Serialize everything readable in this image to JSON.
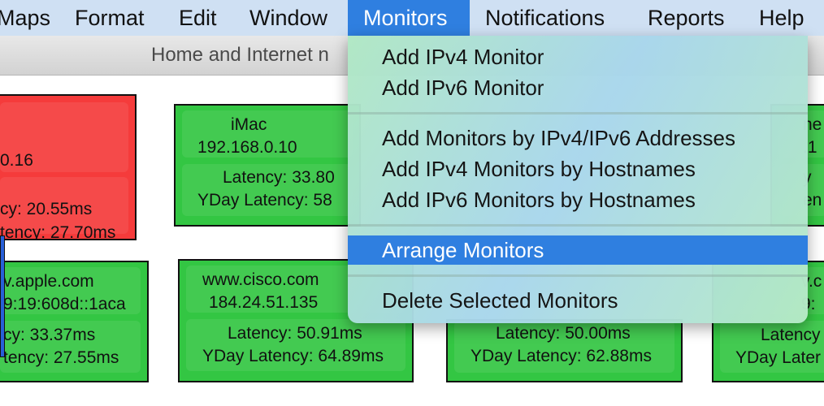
{
  "menubar": {
    "items": [
      "Maps",
      "Format",
      "Edit",
      "Window",
      "Monitors",
      "Notifications",
      "Reports",
      "Help"
    ],
    "active": "Monitors"
  },
  "window": {
    "title": "Home and Internet n"
  },
  "tiles": [
    {
      "l1": "0.16",
      "l2": "cy: 20.55ms",
      "l3": "tency: 27.70ms"
    },
    {
      "l1": "iMac",
      "l2": "192.168.0.10",
      "l3": "Latency: 33.80",
      "l4": "YDay Latency: 58"
    },
    {
      "l1": "ne",
      "l2": ".1",
      "l3": "y",
      "l4": "en"
    },
    {
      "l1": "v.apple.com",
      "l2": "9:19:608d::1aca",
      "l3": "cy: 33.37ms",
      "l4": "tency: 27.55ms"
    },
    {
      "l1": "www.cisco.com",
      "l2": "184.24.51.135",
      "l3": "Latency: 50.91ms",
      "l4": "YDay Latency: 64.89ms"
    },
    {
      "l3": "Latency: 50.00ms",
      "l4": "YDay Latency: 62.88ms"
    },
    {
      "l1": "v.c",
      "l2": "9:",
      "l3": "Latency",
      "l4": "YDay Later"
    }
  ],
  "menu": {
    "items": [
      "Add IPv4 Monitor",
      "Add IPv6 Monitor",
      "Add Monitors by IPv4/IPv6 Addresses",
      "Add IPv4 Monitors by Hostnames",
      "Add IPv6 Monitors by Hostnames",
      "Arrange Monitors",
      "Delete Selected Monitors"
    ],
    "highlighted": "Arrange Monitors"
  },
  "colors": {
    "menubar": "#cfe0f3",
    "menu_highlight": "#2f7fe0",
    "tile_up": "#33c643",
    "tile_down": "#f53b3b",
    "selection_strip": "#2860d8"
  }
}
